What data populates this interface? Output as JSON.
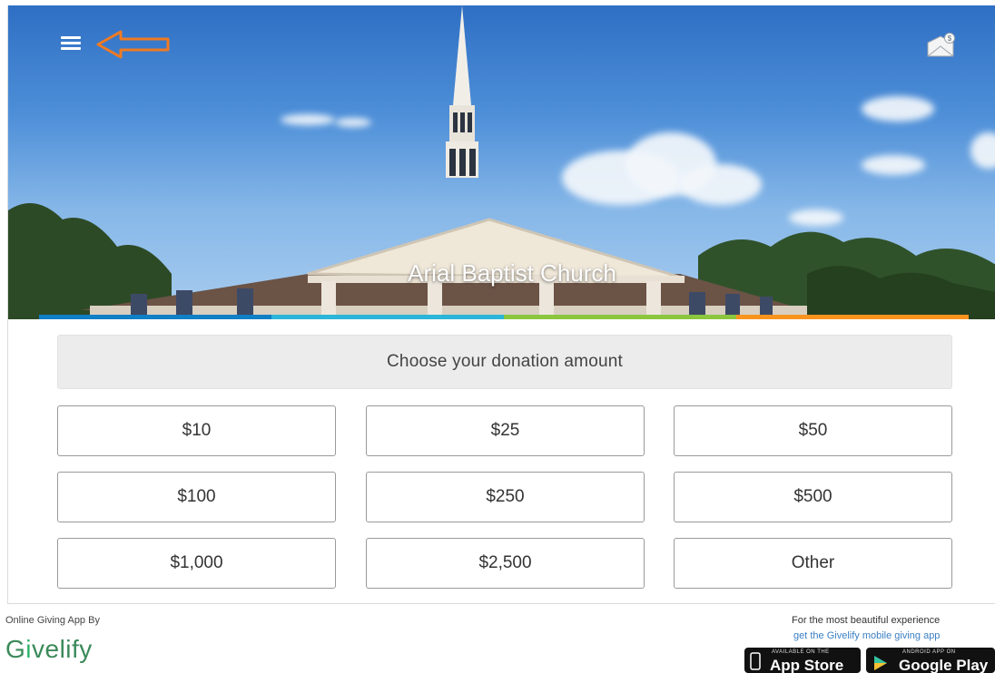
{
  "hero": {
    "church_name": "Arial Baptist Church",
    "menu_icon": "hamburger-menu-icon",
    "arrow_icon": "arrow-left-icon",
    "envelope_icon": "envelope-dollar-icon",
    "accent_colors": [
      "#0f7fc6",
      "#2bb5d8",
      "#8cc63f",
      "#f7941d"
    ]
  },
  "donation": {
    "heading": "Choose your donation amount",
    "amounts": [
      "$10",
      "$25",
      "$50",
      "$100",
      "$250",
      "$500",
      "$1,000",
      "$2,500",
      "Other"
    ]
  },
  "footer": {
    "by_label": "Online Giving App By",
    "logo_text": "Givelify",
    "promo_line1": "For the most beautiful experience",
    "promo_line2": "get the Givelify mobile giving app",
    "app_store": {
      "small": "AVAILABLE ON THE",
      "big": "App Store"
    },
    "google_play": {
      "small": "ANDROID APP ON",
      "big": "Google Play"
    }
  }
}
